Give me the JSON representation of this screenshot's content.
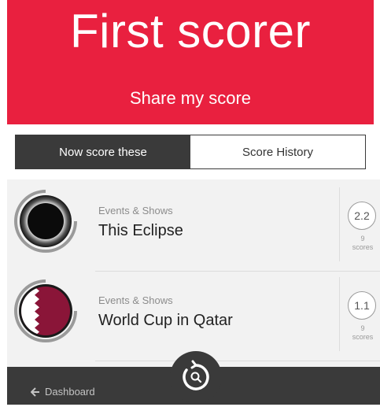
{
  "hero": {
    "title": "First scorer",
    "share_label": "Share my score"
  },
  "tabs": [
    {
      "label": "Now score these",
      "active": true
    },
    {
      "label": "Score History",
      "active": false
    }
  ],
  "items": [
    {
      "category": "Events & Shows",
      "title": "This Eclipse",
      "score": "2.2",
      "count": "9",
      "count_label": "scores",
      "thumb_icon": "eclipse-icon"
    },
    {
      "category": "Events & Shows",
      "title": "World Cup in Qatar",
      "score": "1.1",
      "count": "9",
      "count_label": "scores",
      "thumb_icon": "qatar-flag-icon"
    }
  ],
  "footer": {
    "back_label": "Dashboard",
    "back_icon": "arrow-left-icon",
    "fab_icon": "search-refresh-icon"
  },
  "colors": {
    "accent": "#e9203f",
    "dark": "#3a3a3a",
    "list_bg": "#f2f2f2"
  }
}
